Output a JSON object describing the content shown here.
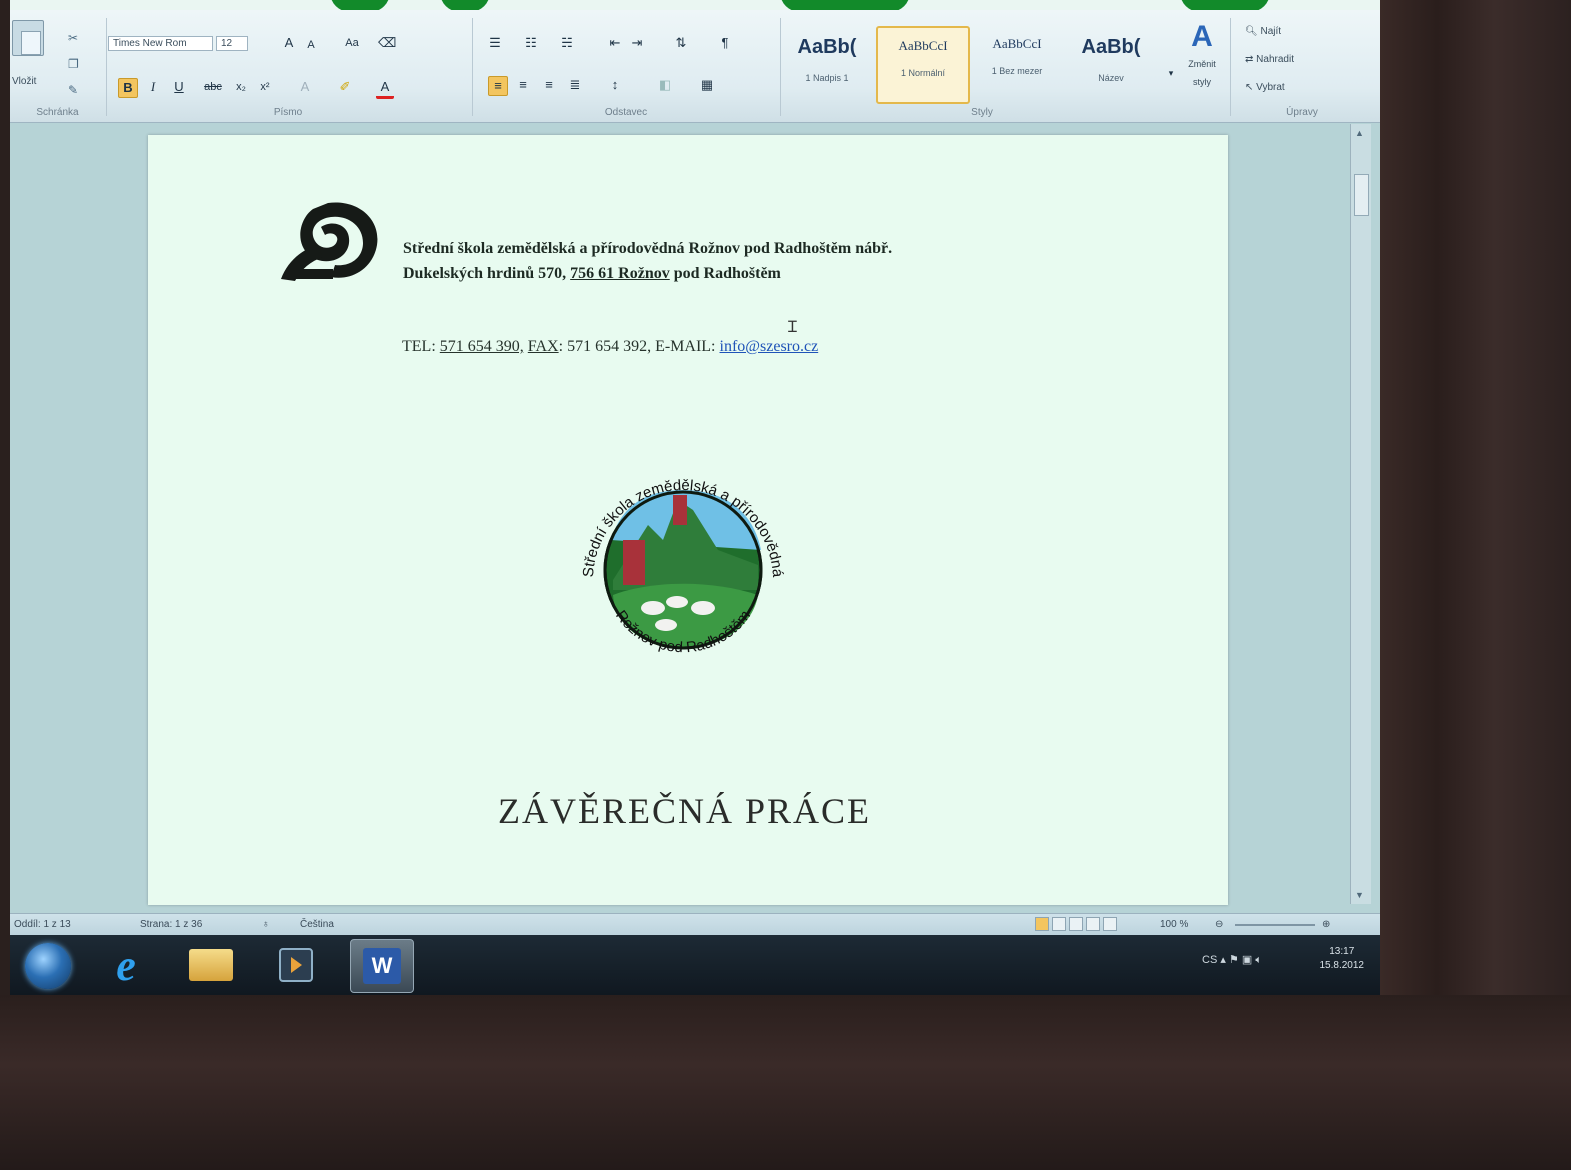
{
  "ribbon": {
    "clipboard": {
      "paste_label": "Vložit",
      "group_label": "Schránka"
    },
    "font": {
      "font_name": "Times New Rom",
      "font_size": "12",
      "group_label": "Písmo"
    },
    "paragraph": {
      "group_label": "Odstavec"
    },
    "styles": {
      "group_label": "Styly",
      "items": [
        {
          "sample": "AaBb(",
          "name": "1 Nadpis 1"
        },
        {
          "sample": "AaBbCcI",
          "name": "1 Normální"
        },
        {
          "sample": "AaBbCcI",
          "name": "1 Bez mezer"
        },
        {
          "sample": "AaBb(",
          "name": "Název"
        }
      ],
      "change_styles": "Změnit styly"
    },
    "editing": {
      "group_label": "Úpravy",
      "find": "Najít",
      "replace": "Nahradit",
      "select": "Vybrat"
    }
  },
  "document": {
    "school_line_1": "Střední škola zemědělská a přírodovědná Rožnov pod Radhoštěm nábř.",
    "school_line_2_prefix": "Dukelských hrdinů 570, ",
    "school_line_2_zip": "756 61 Rožnov",
    "school_line_2_suffix": " pod Radhoštěm",
    "contact_tel_label": "TEL",
    "contact_tel": "571 654 390,",
    "contact_fax_label": "FAX",
    "contact_fax": "571 654 392,",
    "contact_email_label": "E-MAIL:",
    "contact_email": "info@szesro.cz",
    "emblem_top_text": "Střední škola zemědělská a přírodovědná",
    "emblem_bottom_text": "Rožnov pod Radhoštěm",
    "title": "ZÁVĚREČNÁ PRÁCE"
  },
  "statusbar": {
    "section": "Oddíl: 1 z 13",
    "page": "Strana: 1 z 36",
    "language": "Čeština",
    "zoom": "100 %"
  },
  "taskbar": {
    "word_label": "W",
    "clock_time": "13:17",
    "clock_date": "15.8.2012",
    "tray_lang": "CS"
  },
  "colors": {
    "page_bg": "#e8fbf0",
    "link": "#1f53b8",
    "style_highlight": "#e4b84b",
    "emblem_green": "#1f6e2c"
  }
}
